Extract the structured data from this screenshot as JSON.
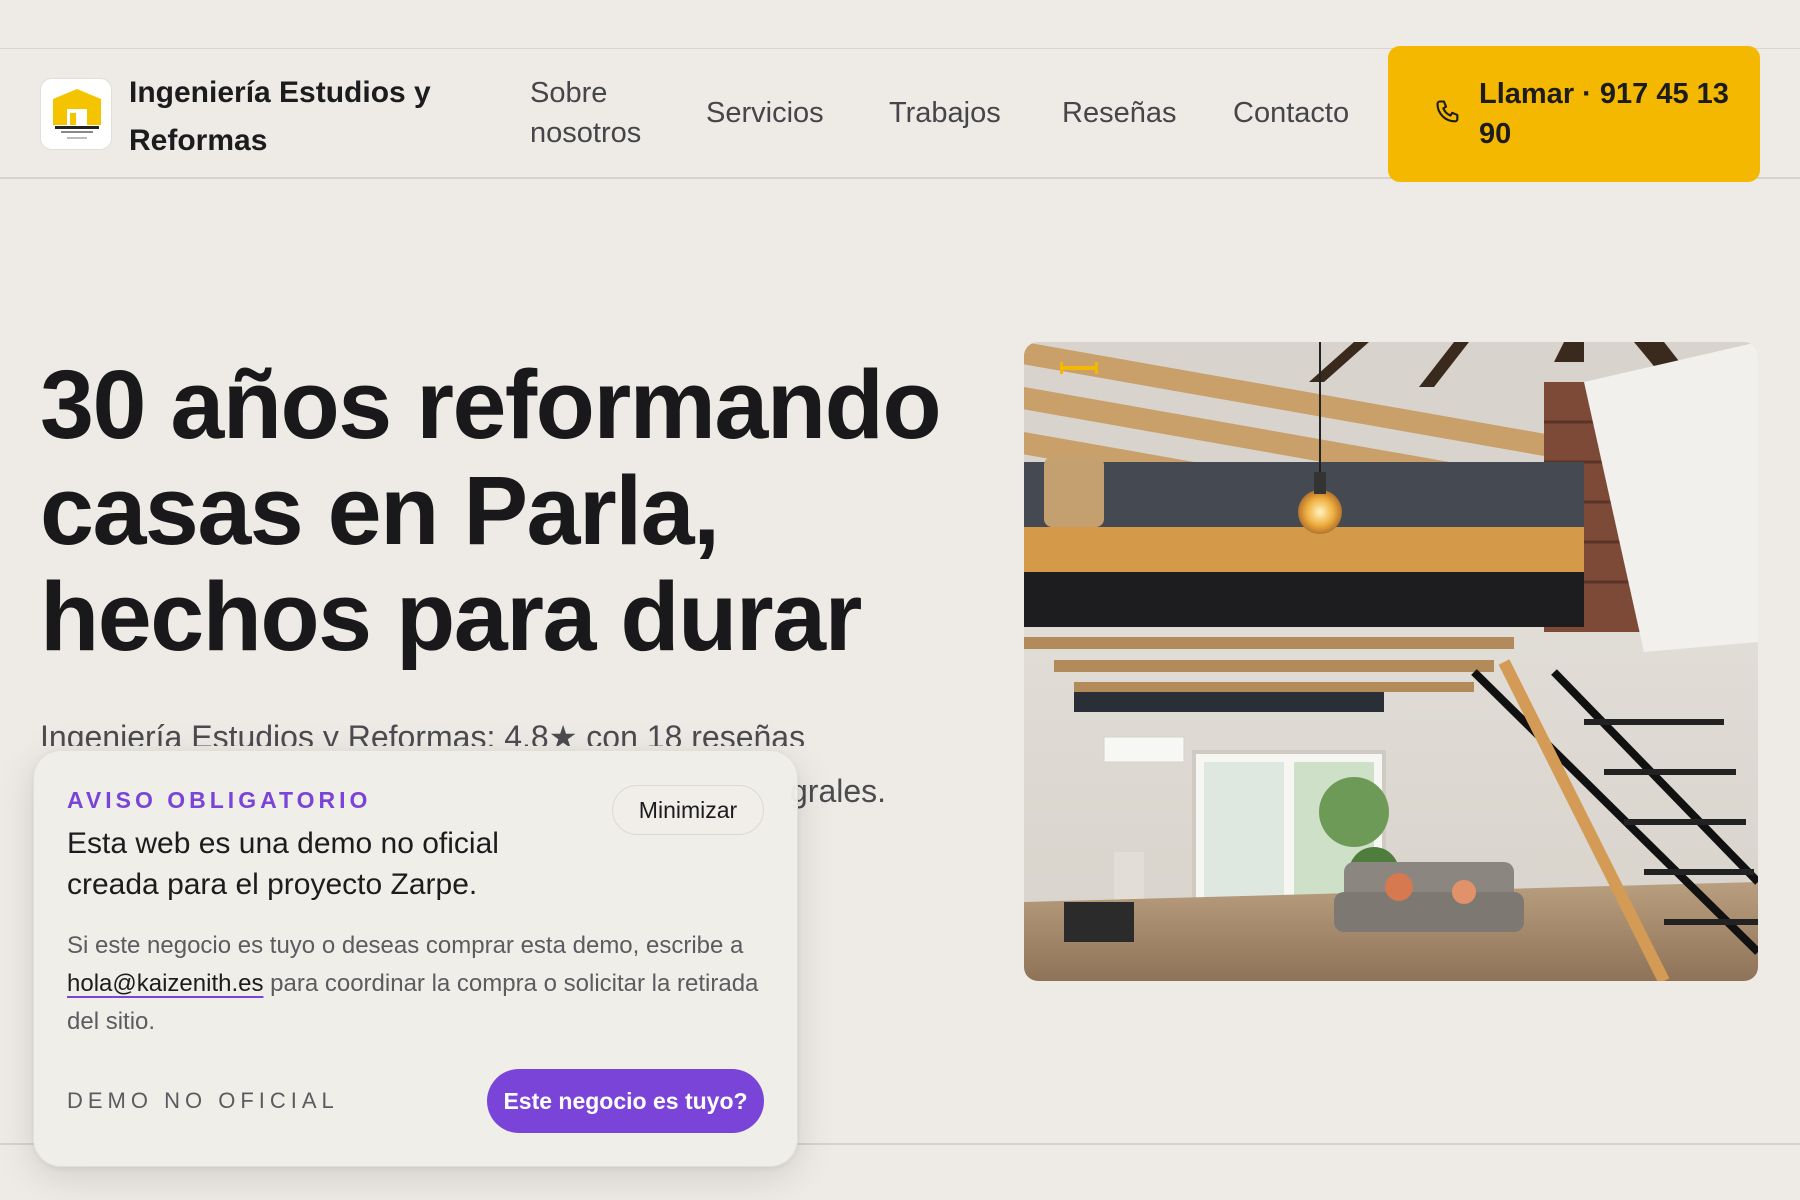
{
  "header": {
    "brand_name": "Ingeniería Estudios y Reformas",
    "nav": [
      {
        "label": "Sobre nosotros"
      },
      {
        "label": "Servicios"
      },
      {
        "label": "Trabajos"
      },
      {
        "label": "Reseñas"
      },
      {
        "label": "Contacto"
      }
    ],
    "call_button": {
      "label": "Llamar · 917 45 13 90",
      "icon": "phone-icon"
    }
  },
  "hero": {
    "title": "30 años reformando casas en Parla, hechos para durar",
    "subtitle": "Ingeniería Estudios y Reformas: 4.8★ con 18 reseñas",
    "subtitle_tail": "grales.",
    "image": "interior-loft-photo"
  },
  "notice": {
    "kicker": "AVISO OBLIGATORIO",
    "minimize_label": "Minimizar",
    "title": "Esta web es una demo no oficial creada para el proyecto Zarpe.",
    "body_before": "Si este negocio es tuyo o deseas comprar esta demo, escribe a",
    "email": "hola@kaizenith.es",
    "body_after": "para coordinar la compra o solicitar la retirada del sitio.",
    "demo_tag": "DEMO NO OFICIAL",
    "claim_label": "Este negocio es tuyo?"
  },
  "colors": {
    "background": "#eeebe6",
    "accent_yellow": "#f5b800",
    "accent_purple": "#7a44d9",
    "text_dark": "#1c1c1e"
  }
}
